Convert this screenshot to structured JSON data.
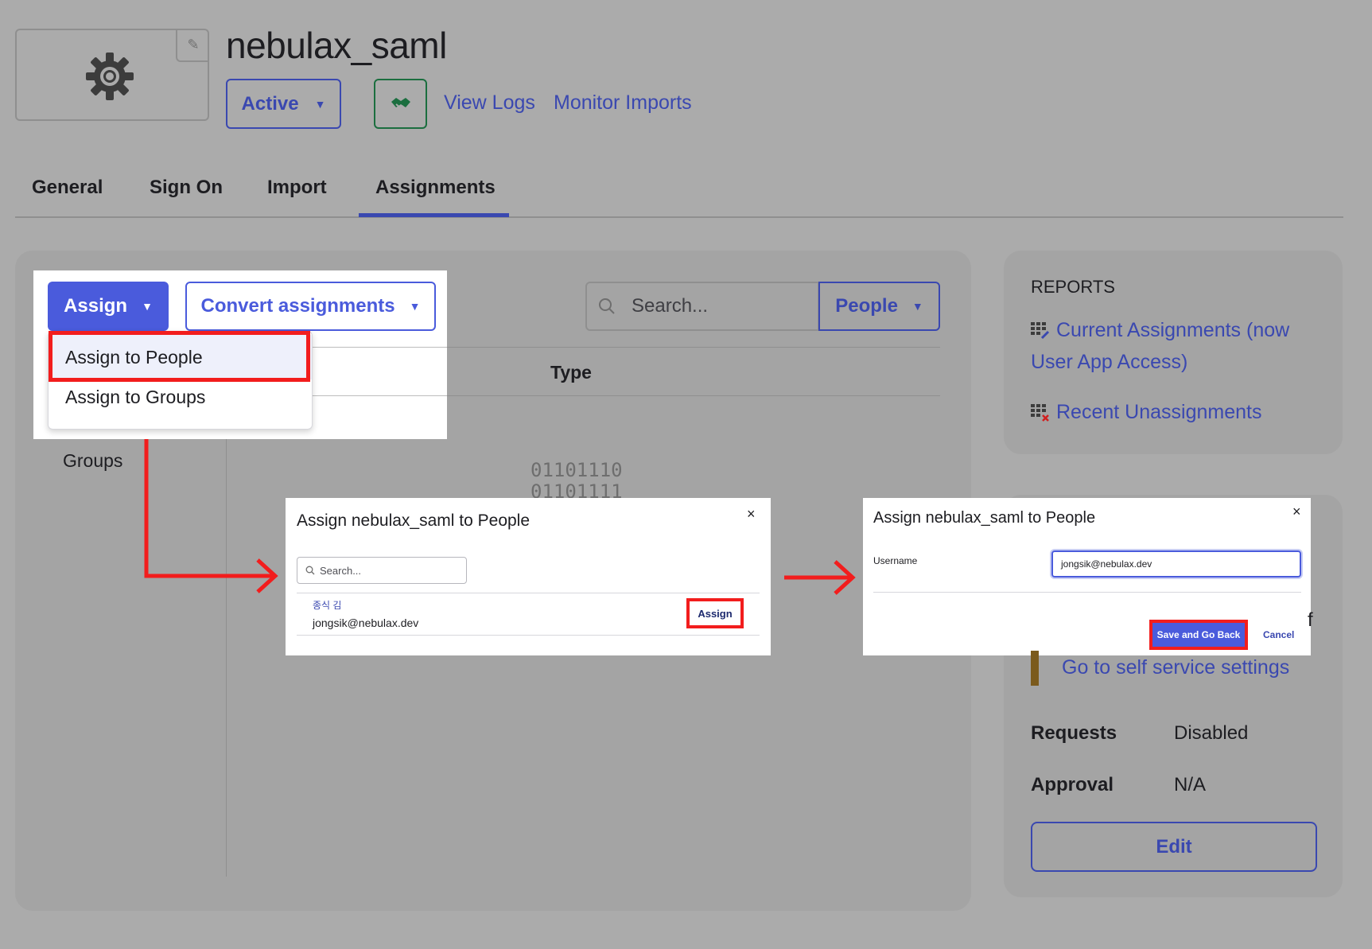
{
  "app": {
    "title": "nebulax_saml",
    "status_label": "Active",
    "view_logs": "View Logs",
    "monitor_imports": "Monitor Imports"
  },
  "tabs": [
    {
      "label": "General"
    },
    {
      "label": "Sign On"
    },
    {
      "label": "Import"
    },
    {
      "label": "Assignments",
      "active": true
    }
  ],
  "toolbar": {
    "assign_label": "Assign",
    "convert_label": "Convert assignments",
    "search_placeholder": "Search...",
    "filter_label": "People"
  },
  "assign_menu": {
    "items": [
      {
        "label": "Assign to People",
        "highlighted": true
      },
      {
        "label": "Assign to Groups"
      }
    ]
  },
  "table": {
    "type_header": "Type",
    "groups_label": "Groups",
    "empty_binary": [
      "01101110",
      "01101111"
    ]
  },
  "modal_people": {
    "title": "Assign nebulax_saml to People",
    "close": "×",
    "search_placeholder": "Search...",
    "user_name": "종식 김",
    "user_email": "jongsik@nebulax.dev",
    "assign_label": "Assign"
  },
  "modal_username": {
    "title": "Assign nebulax_saml to People",
    "close": "×",
    "username_label": "Username",
    "username_value": "jongsik@nebulax.dev",
    "save_label": "Save and Go Back",
    "cancel_label": "Cancel"
  },
  "reports": {
    "title": "REPORTS",
    "links": [
      {
        "label": "Current Assignments (now User App Access)"
      },
      {
        "label": "Recent Unassignments"
      }
    ]
  },
  "self_service": {
    "partial_text": "f",
    "link": "Go to self service settings",
    "requests_label": "Requests",
    "requests_value": "Disabled",
    "approval_label": "Approval",
    "approval_value": "N/A",
    "edit_label": "Edit"
  },
  "colors": {
    "accent": "#3a48b0",
    "primary_button": "#4a5bdc",
    "highlight_red": "#f21d1d",
    "overlay_gray": "#ababab"
  }
}
